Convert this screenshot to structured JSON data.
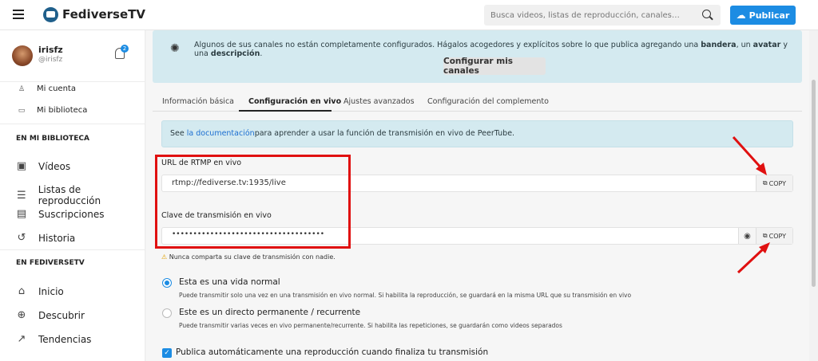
{
  "header": {
    "logo_text": "FediverseTV",
    "search_placeholder": "Busca videos, listas de reproducción, canales…",
    "publish_label": "Publicar"
  },
  "user": {
    "name": "irisfz",
    "handle": "@irisfz",
    "notification_count": "2"
  },
  "sidebar": {
    "account_links": [
      {
        "label": "Mi cuenta"
      },
      {
        "label": "Mi biblioteca"
      }
    ],
    "library_title": "EN MI BIBLIOTECA",
    "library_items": [
      {
        "label": "Vídeos"
      },
      {
        "label": "Listas de reproducción"
      },
      {
        "label": "Suscripciones"
      },
      {
        "label": "Historia"
      }
    ],
    "instance_title": "EN FEDIVERSETV",
    "instance_items": [
      {
        "label": "Inicio"
      },
      {
        "label": "Descubrir"
      },
      {
        "label": "Tendencias"
      }
    ]
  },
  "banner": {
    "text_before": "Algunos de sus canales no están completamente configurados. Hágalos acogedores y explícitos sobre lo que publica agregando una ",
    "bandera": "bandera",
    "sep1": ", un ",
    "avatar": "avatar",
    "sep2": " y una ",
    "descripcion": "descripción",
    "text_end": ".",
    "button_label": "Configurar mis canales"
  },
  "tabs": [
    {
      "label": "Información básica"
    },
    {
      "label": "Configuración en vivo"
    },
    {
      "label": "Ajustes avanzados"
    },
    {
      "label": "Configuración del complemento"
    }
  ],
  "info": {
    "prefix": "See ",
    "link": "la documentación",
    "suffix": "para aprender a usar la función de transmisión en vivo de PeerTube."
  },
  "rtmp": {
    "label": "URL de RTMP en vivo",
    "value": "rtmp://fediverse.tv:1935/live",
    "copy_label": "COPY"
  },
  "stream_key": {
    "label": "Clave de transmisión en vivo",
    "value": "••••••••••••••••••••••••••••••••••••",
    "copy_label": "COPY",
    "warning": "Nunca comparta su clave de transmisión con nadie."
  },
  "options": [
    {
      "label": "Esta es una vida normal",
      "desc": "Puede transmitir solo una vez en una transmisión en vivo normal. Si habilita la reproducción, se guardará en la misma URL que su transmisión en vivo",
      "selected": true
    },
    {
      "label": "Este es un directo permanente / recurrente",
      "desc": "Puede transmitir varias veces en vivo permanente/recurrente. Si habilita las repeticiones, se guardarán como videos separados",
      "selected": false
    }
  ],
  "checkbox_label": "Publica automáticamente una reproducción cuando finaliza tu transmisión",
  "colors": {
    "accent": "#1c8ce3",
    "banner_bg": "#d4eaf0",
    "annotation_red": "#e01010"
  }
}
